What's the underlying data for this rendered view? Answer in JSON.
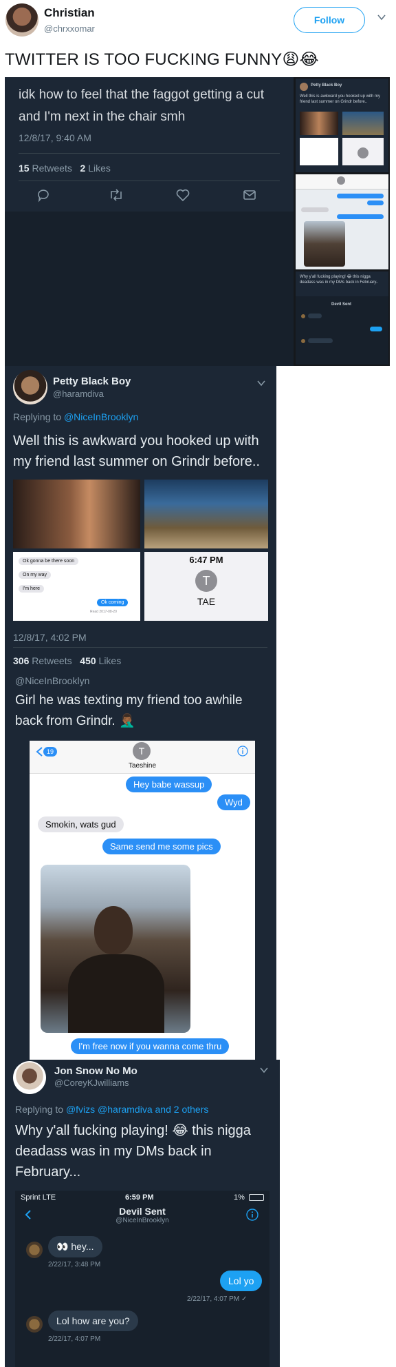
{
  "tweet": {
    "author_name": "Christian",
    "author_handle": "@chrxxomar",
    "follow_label": "Follow",
    "text": "TWITTER IS TOO FUCKING FUNNY😩😂"
  },
  "quoted_1": {
    "text": "idk how to feel that the faggot getting a cut and I'm next in the chair smh",
    "date": "12/8/17, 9:40 AM",
    "retweets_count": "15",
    "retweets_label": "Retweets",
    "likes_count": "2",
    "likes_label": "Likes",
    "icons": [
      "reply-icon",
      "retweet-icon",
      "like-icon",
      "dm-icon"
    ]
  },
  "thumbs": {
    "t1_name": "Petty Black Boy",
    "t1_text": "Well this is awkward you hooked up with my friend last summer on Grindr before..",
    "t3_text": "Why y'all fucking playing! 😂 this nigga deadass was in my DMs back in February..",
    "t3_title": "Devil Sent"
  },
  "quoted_2": {
    "author_name": "Petty Black Boy",
    "author_handle": "@haramdiva",
    "reply_prefix": "Replying to",
    "reply_to": "@NiceInBrooklyn",
    "text": "Well this is awkward you hooked up with my friend last summer on Grindr before..",
    "sms": [
      "Ok gonna be there soon",
      "On my way",
      "I'm here",
      "Ok coming"
    ],
    "sms_read": "Read 2017-08-20",
    "contact_time": "6:47 PM",
    "contact_initial": "T",
    "contact_name": "TAE",
    "date": "12/8/17, 4:02 PM",
    "retweets_count": "306",
    "retweets_label": "Retweets",
    "likes_count": "450",
    "likes_label": "Likes"
  },
  "quoted_3": {
    "cut_handle": "@NiceInBrooklyn",
    "text": "Girl he was texting my friend too awhile back from Grindr. 🤦🏾‍♂️",
    "back_count": "19",
    "contact_initial": "T",
    "contact_name": "Taeshine",
    "messages": [
      "Hey babe wassup",
      "Wyd",
      "Smokin, wats gud",
      "Same send me some pics",
      "I'm free now if you wanna come thru"
    ]
  },
  "quoted_4": {
    "author_name": "Jon Snow No Mo",
    "author_handle": "@CoreyKJwilliams",
    "reply_prefix": "Replying to",
    "reply_to": "@fvizs @haramdiva",
    "reply_suffix": "and 2 others",
    "text": "Why y'all fucking playing! 😂 this nigga deadass was in my DMs back in February...",
    "status_carrier": "Sprint  LTE",
    "status_time": "6:59 PM",
    "status_battery": "1%",
    "dm_title": "Devil Sent",
    "dm_handle": "@NiceInBrooklyn",
    "dm_messages": [
      {
        "text": "👀 hey...",
        "time": "2/22/17, 3:48 PM",
        "dir": "in"
      },
      {
        "text": "Lol yo",
        "time": "2/22/17, 4:07 PM ✓",
        "dir": "out"
      },
      {
        "text": "Lol how are you?",
        "time": "2/22/17, 4:07 PM",
        "dir": "in"
      }
    ]
  },
  "colors": {
    "accent": "#1da1f2",
    "dark_bg": "#1c2735",
    "imessage_blue": "#2b8ff6"
  }
}
